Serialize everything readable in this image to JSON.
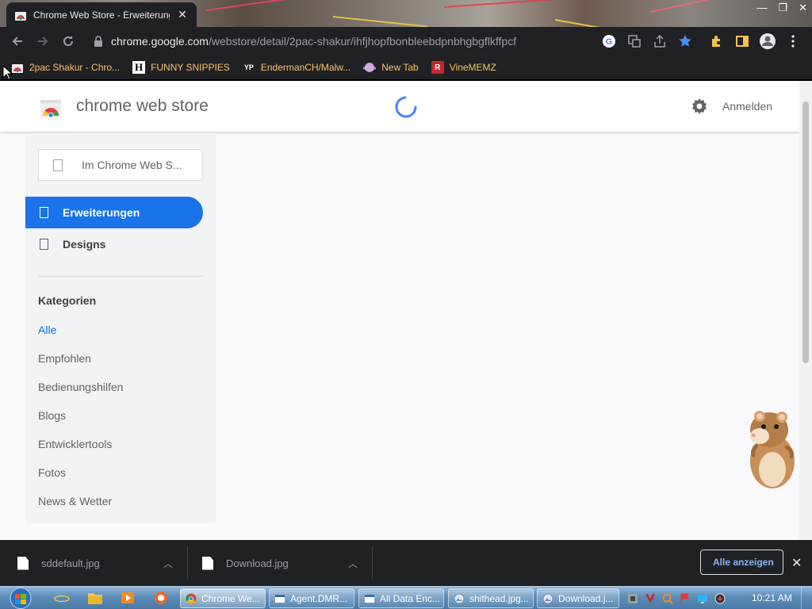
{
  "browser": {
    "tab_title": "Chrome Web Store - Erweiterungen",
    "url_host": "chrome.google.com",
    "url_path": "/webstore/detail/2pac-shakur/ihfjhopfbonbleebdpnbhgbgflkffpcf"
  },
  "bookmarks": [
    {
      "label": "2pac Shakur - Chro...",
      "icon": "webstore-favicon"
    },
    {
      "label": "FUNNY SNIPPIES",
      "icon": "H-favicon"
    },
    {
      "label": "EndermanCH/Malw...",
      "icon": "YP-favicon"
    },
    {
      "label": "New Tab",
      "icon": "planet-favicon"
    },
    {
      "label": "VineMEMZ",
      "icon": "R-favicon"
    }
  ],
  "store": {
    "brand": "chrome web store",
    "signin": "Anmelden",
    "search_placeholder": "Im Chrome Web S...",
    "nav": [
      {
        "label": "Erweiterungen",
        "active": true
      },
      {
        "label": "Designs",
        "active": false
      }
    ],
    "categories_title": "Kategorien",
    "categories": [
      "Alle",
      "Empfohlen",
      "Bedienungshilfen",
      "Blogs",
      "Entwicklertools",
      "Fotos",
      "News & Wetter"
    ],
    "selected_category": "Alle"
  },
  "downloads": {
    "items": [
      "sddefault.jpg",
      "Download.jpg"
    ],
    "show_all": "Alle anzeigen"
  },
  "taskbar": {
    "buttons": [
      {
        "label": "Chrome We...",
        "icon": "chrome-icon",
        "active": true
      },
      {
        "label": "Agent.DMR...",
        "icon": "window-icon",
        "active": false
      },
      {
        "label": "All Data Enc...",
        "icon": "window-icon",
        "active": false
      },
      {
        "label": "shithead.jpg...",
        "icon": "image-viewer-icon",
        "active": false
      },
      {
        "label": "Download.j...",
        "icon": "image-viewer-icon",
        "active": false
      }
    ],
    "clock": "10:21 AM"
  },
  "colors": {
    "accent": "#1a73e8",
    "chrome_dark": "#202124",
    "bookmark_text": "#f5c56b"
  }
}
